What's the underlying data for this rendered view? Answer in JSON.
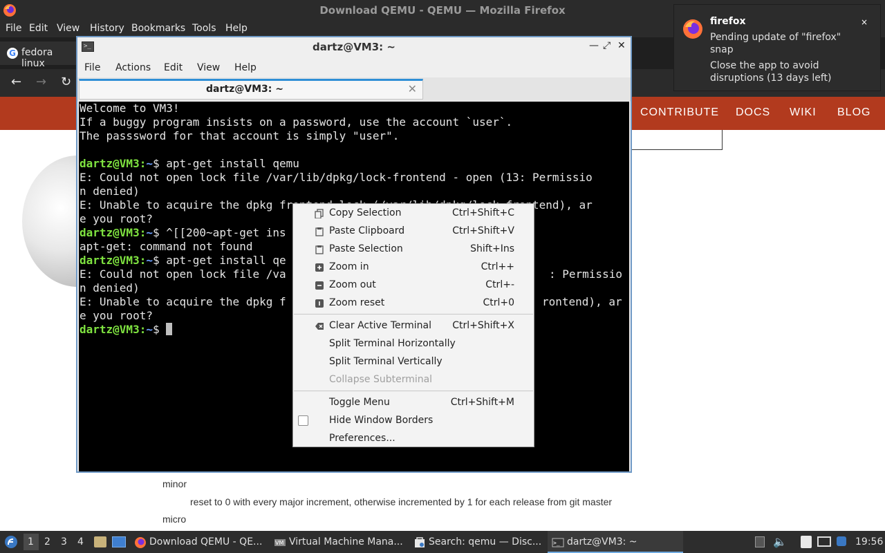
{
  "firefox": {
    "window_title": "Download QEMU - QEMU — Mozilla Firefox",
    "menu": [
      "File",
      "Edit",
      "View",
      "History",
      "Bookmarks",
      "Tools",
      "Help"
    ],
    "tab_title": "fedora linux",
    "site_nav": [
      "CONTRIBUTE",
      "DOCS",
      "WIKI",
      "BLOG"
    ],
    "page_text": {
      "minor": "minor",
      "minor_desc": "reset to 0 with every major increment, otherwise incremented by 1 for each release from git master",
      "micro": "micro"
    }
  },
  "notification": {
    "app": "firefox",
    "summary": "Pending update of \"firefox\" snap",
    "body": "Close the app to avoid disruptions (13 days left)",
    "close": "×"
  },
  "terminal": {
    "window_title": "dartz@VM3: ~",
    "menu": [
      "File",
      "Actions",
      "Edit",
      "View",
      "Help"
    ],
    "tab_label": "dartz@VM3: ~",
    "tab_close": "✕",
    "prompt_user": "dartz@VM3",
    "prompt_sep": ":",
    "prompt_dir": "~",
    "prompt_end": "$ ",
    "lines": [
      "Welcome to VM3!",
      "If a buggy program insists on a password, use the account `user`.",
      "The passsword for that account is simply \"user\".",
      "",
      "apt-get install qemu",
      "E: Could not open lock file /var/lib/dpkg/lock-frontend - open (13: Permissio",
      "n denied)",
      "E: Unable to acquire the dpkg frontend lock (/var/lib/dpkg/lock-frontend), ar",
      "e you root?",
      "^[[200~apt-get ins",
      "apt-get: command not found",
      "apt-get install qe",
      "E: Could not open lock file /va",
      "n denied)",
      "E: Unable to acquire the dpkg f",
      "e you root?",
      ""
    ],
    "line_tails": {
      "12": ": Permissio",
      "14": "rontend), ar"
    }
  },
  "context_menu": {
    "items": [
      {
        "label": "Copy Selection",
        "shortcut": "Ctrl+Shift+C",
        "icon": "copy-icon"
      },
      {
        "label": "Paste Clipboard",
        "shortcut": "Ctrl+Shift+V",
        "icon": "paste-icon"
      },
      {
        "label": "Paste Selection",
        "shortcut": "Shift+Ins",
        "icon": "paste-icon"
      },
      {
        "label": "Zoom in",
        "shortcut": "Ctrl++",
        "icon": "zoom-in-icon"
      },
      {
        "label": "Zoom out",
        "shortcut": "Ctrl+-",
        "icon": "zoom-out-icon"
      },
      {
        "label": "Zoom reset",
        "shortcut": "Ctrl+0",
        "icon": "zoom-reset-icon"
      },
      {
        "label": "Clear Active Terminal",
        "shortcut": "Ctrl+Shift+X",
        "icon": "clear-icon"
      },
      {
        "label": "Split Terminal Horizontally",
        "shortcut": ""
      },
      {
        "label": "Split Terminal Vertically",
        "shortcut": ""
      },
      {
        "label": "Collapse Subterminal",
        "shortcut": "",
        "disabled": true
      },
      {
        "label": "Toggle Menu",
        "shortcut": "Ctrl+Shift+M"
      },
      {
        "label": "Hide Window Borders",
        "shortcut": "",
        "checkbox": false
      },
      {
        "label": "Preferences...",
        "shortcut": ""
      }
    ]
  },
  "taskbar": {
    "workspaces": [
      "1",
      "2",
      "3",
      "4"
    ],
    "tasks": [
      {
        "label": "Download QEMU - QE...",
        "icon": "firefox-icon"
      },
      {
        "label": "Virtual Machine Mana...",
        "icon": "virt-manager-icon"
      },
      {
        "label": "Search: qemu — Disc...",
        "icon": "discover-icon"
      },
      {
        "label": "dartz@VM3: ~",
        "icon": "terminal-icon"
      }
    ],
    "clock": "19:56"
  }
}
